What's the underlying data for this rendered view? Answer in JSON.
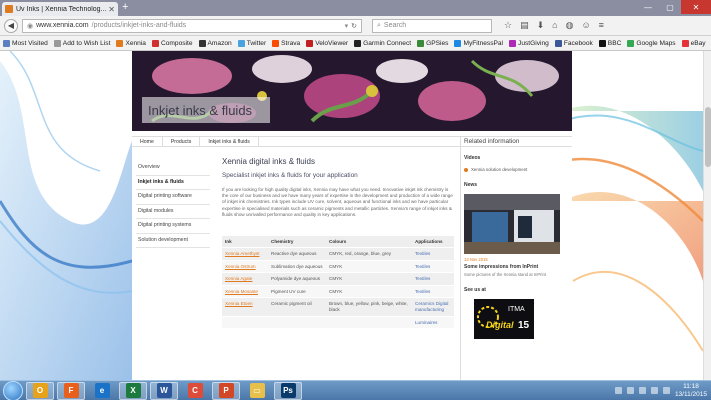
{
  "browser": {
    "tab_title": "Uv Inks | Xennia Technolog...",
    "url_domain": "www.xennia.com",
    "url_path": "/products/inkjet-inks-and-fluids",
    "search_placeholder": "Search"
  },
  "bookmarks": [
    {
      "label": "Most Visited",
      "color": "#5b7fbf"
    },
    {
      "label": "Add to Wish List",
      "color": "#999999"
    },
    {
      "label": "Xennia",
      "color": "#e07a1f"
    },
    {
      "label": "Composite",
      "color": "#d22f2f"
    },
    {
      "label": "Amazon",
      "color": "#333333"
    },
    {
      "label": "Twitter",
      "color": "#4aa3df"
    },
    {
      "label": "Strava",
      "color": "#fc4c02"
    },
    {
      "label": "VeloViewer",
      "color": "#c22020"
    },
    {
      "label": "Garmin Connect",
      "color": "#222222"
    },
    {
      "label": "GPSies",
      "color": "#3a8a3a"
    },
    {
      "label": "MyFitnessPal",
      "color": "#1e88e5"
    },
    {
      "label": "JustGiving",
      "color": "#ad29b6"
    },
    {
      "label": "Facebook",
      "color": "#3b5998"
    },
    {
      "label": "BBC",
      "color": "#111111"
    },
    {
      "label": "Google Maps",
      "color": "#34a853"
    },
    {
      "label": "eBay",
      "color": "#e53238"
    }
  ],
  "page": {
    "banner_title": "Inkjet inks & fluids",
    "breadcrumb": [
      "Home",
      "Products",
      "Inkjet inks & fluids"
    ],
    "leftnav": [
      {
        "label": "Overview",
        "active": false
      },
      {
        "label": "Inkjet inks & fluids",
        "active": true
      },
      {
        "label": "Digital printing software",
        "active": false
      },
      {
        "label": "Digital modules",
        "active": false
      },
      {
        "label": "Digital printing systems",
        "active": false
      },
      {
        "label": "Solution development",
        "active": false
      }
    ],
    "heading": "Xennia digital inks & fluids",
    "subheading": "Specialist inkjet inks & fluids for your application",
    "intro": "If you are looking for high quality digital inks, Xennia may have what you need. Innovative inkjet ink chemistry is the core of our business and we have many years of expertise in the development and production of a wide range of inkjet ink chemistries. Ink types include UV cure, solvent, aqueous and functional inks and we have particular expertise in specialised materials such as ceramic pigments and metallic particles. Xennia's range of inkjet inks & fluids show unrivalled performance and quality in key applications.",
    "table": {
      "headers": [
        "Ink",
        "Chemistry",
        "Colours",
        "Applications"
      ],
      "rows": [
        [
          "Xennia Amethyst",
          "Reactive dye aqueous",
          "CMYK, red, orange, blue, grey",
          "Textiles"
        ],
        [
          "Xennia Ostrum",
          "Sublimation dye aqueous",
          "CMYK",
          "Textiles"
        ],
        [
          "Xennia Agate",
          "Polyamide dye aqueous",
          "CMYK",
          "Textiles"
        ],
        [
          "Xennia Mosaste",
          "Pigment UV cure",
          "CMYK",
          "Textiles"
        ],
        [
          "Xennia Etoen",
          "Ceramic pigment oil",
          "Brown, blue, yellow, pink, beige, white, black",
          "Ceramics Digital manufacturing"
        ],
        [
          "",
          "",
          "",
          "Luminaires"
        ]
      ]
    }
  },
  "sidebar": {
    "title": "Related information",
    "videos_label": "Videos",
    "video_item": "Xennia solution development",
    "news_label": "News",
    "news_date": "13 Nov 2015",
    "news_title": "Some impressions from InPrint",
    "news_text": "Some pictures of the Xennia stand at InPrint",
    "seeus_label": "See us at",
    "itma_text": "ITMA",
    "itma_digital": "Digital",
    "itma_num": "15"
  },
  "taskbar": {
    "apps": [
      {
        "name": "outlook",
        "label": "O",
        "color": "#e6a21a",
        "active": true
      },
      {
        "name": "firefox",
        "label": "F",
        "color": "#e8601c",
        "active": true
      },
      {
        "name": "ie",
        "label": "e",
        "color": "#1b73c8",
        "active": false
      },
      {
        "name": "excel",
        "label": "X",
        "color": "#1d7a3e",
        "active": true
      },
      {
        "name": "word",
        "label": "W",
        "color": "#2b579a",
        "active": true
      },
      {
        "name": "chrome",
        "label": "C",
        "color": "#dd4b39",
        "active": false
      },
      {
        "name": "powerpoint",
        "label": "P",
        "color": "#d24726",
        "active": true
      },
      {
        "name": "folder",
        "label": "▭",
        "color": "#e6c04a",
        "active": false
      },
      {
        "name": "photoshop",
        "label": "Ps",
        "color": "#0a3a6b",
        "active": true
      }
    ],
    "time": "11:18",
    "date": "13/11/2015"
  }
}
